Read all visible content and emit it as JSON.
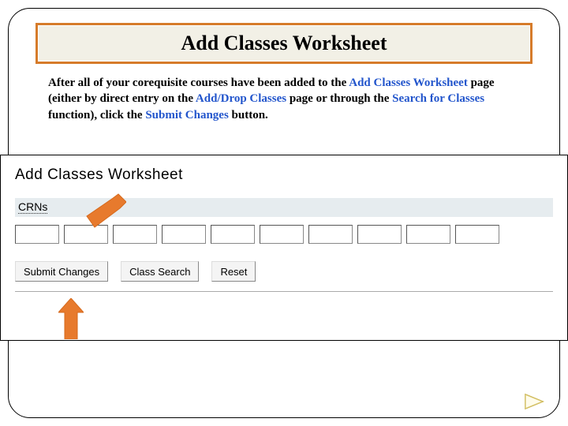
{
  "title": "Add Classes Worksheet",
  "intro": {
    "t1": "After all of your corequisite courses have been added to the ",
    "link1": "Add Classes Worksheet",
    "t2": " page (either by direct entry on the ",
    "link2": "Add/Drop Classes",
    "t3": " page or through the ",
    "link3": "Search for Classes",
    "t4": " function), click the ",
    "link4": "Submit Changes",
    "t5": " button."
  },
  "screenshot": {
    "heading": "Add Classes Worksheet",
    "crns_label": "CRNs",
    "buttons": {
      "submit": "Submit Changes",
      "search": "Class Search",
      "reset": "Reset"
    }
  }
}
